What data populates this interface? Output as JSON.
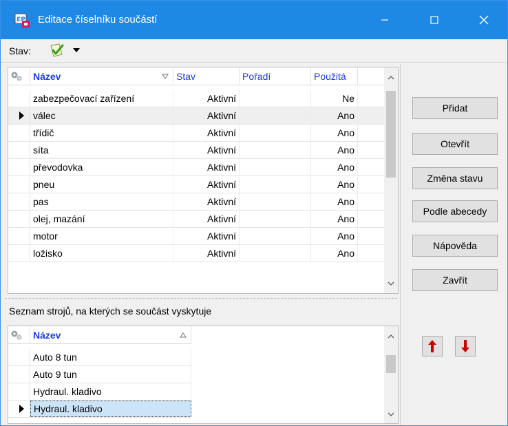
{
  "window": {
    "title": "Editace číselníku součástí",
    "accent": "#1e88e5"
  },
  "status": {
    "label": "Stav:",
    "icon": "check-document-icon",
    "dropdown_icon": "dropdown-arrow-icon"
  },
  "upper_grid": {
    "columns": [
      {
        "label": "Název",
        "sort": "descending"
      },
      {
        "label": "Stav"
      },
      {
        "label": "Pořadí"
      },
      {
        "label": "Použitá"
      }
    ],
    "rows": [
      {
        "nazev": "zabezpečovací zařízení",
        "stav": "Aktivní",
        "poradi": "",
        "pouzita": "Ne"
      },
      {
        "nazev": "válec",
        "stav": "Aktivní",
        "poradi": "",
        "pouzita": "Ano",
        "current": true
      },
      {
        "nazev": "třídič",
        "stav": "Aktivní",
        "poradi": "",
        "pouzita": "Ano"
      },
      {
        "nazev": "síta",
        "stav": "Aktivní",
        "poradi": "",
        "pouzita": "Ano"
      },
      {
        "nazev": "převodovka",
        "stav": "Aktivní",
        "poradi": "",
        "pouzita": "Ano"
      },
      {
        "nazev": "pneu",
        "stav": "Aktivní",
        "poradi": "",
        "pouzita": "Ano"
      },
      {
        "nazev": "pas",
        "stav": "Aktivní",
        "poradi": "",
        "pouzita": "Ano"
      },
      {
        "nazev": "olej, mazání",
        "stav": "Aktivní",
        "poradi": "",
        "pouzita": "Ano"
      },
      {
        "nazev": "motor",
        "stav": "Aktivní",
        "poradi": "",
        "pouzita": "Ano"
      },
      {
        "nazev": "ložisko",
        "stav": "Aktivní",
        "poradi": "",
        "pouzita": "Ano"
      }
    ]
  },
  "lower_section": {
    "label": "Seznam strojů, na kterých se součást vyskytuje",
    "column": {
      "label": "Název",
      "sort": "ascending"
    },
    "rows": [
      {
        "nazev": "Auto 8 tun"
      },
      {
        "nazev": "Auto 9 tun"
      },
      {
        "nazev": "Hydraul. kladivo"
      },
      {
        "nazev": "Hydraul. kladivo",
        "current": true
      }
    ],
    "selected_color": "#cce4f7"
  },
  "buttons": {
    "pridat": "Přidat",
    "otevrit": "Otevřít",
    "zmena_stavu": "Změna stavu",
    "podle_abecedy": "Podle abecedy",
    "napoveda": "Nápověda",
    "zavrit": "Zavřít",
    "move_up_icon": "arrow-up-icon",
    "move_down_icon": "arrow-down-icon",
    "arrow_color": "#cc0000"
  }
}
